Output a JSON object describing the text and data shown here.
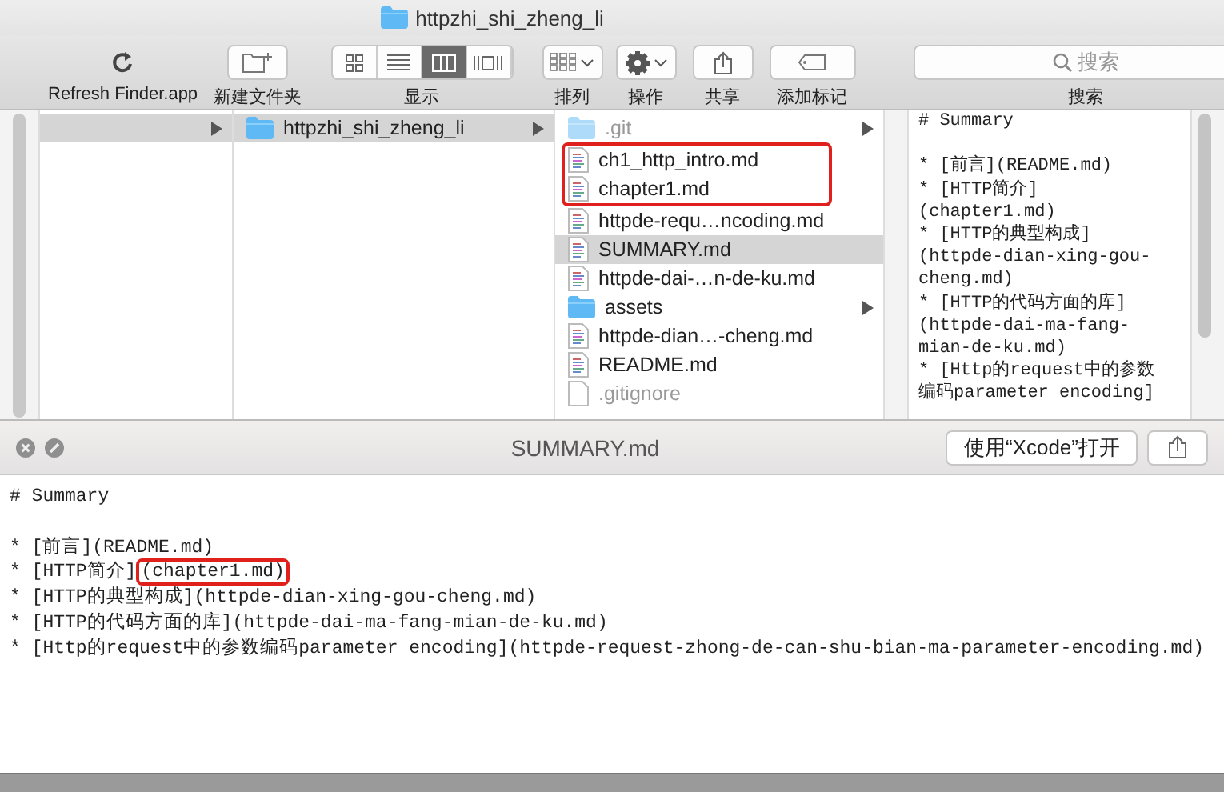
{
  "window": {
    "title": "httpzhi_shi_zheng_li"
  },
  "toolbar": {
    "items": [
      {
        "kind": "refresh",
        "label": "Refresh Finder.app"
      },
      {
        "kind": "new-folder",
        "label": "新建文件夹"
      },
      {
        "kind": "view",
        "label": "显示",
        "segments": [
          {
            "selected": false
          },
          {
            "selected": false
          },
          {
            "selected": true
          },
          {
            "selected": false
          }
        ]
      },
      {
        "kind": "sort",
        "label": "排列"
      },
      {
        "kind": "action",
        "label": "操作"
      },
      {
        "kind": "share",
        "label": "共享"
      },
      {
        "kind": "tag",
        "label": "添加标记"
      },
      {
        "kind": "search",
        "label": "搜索",
        "placeholder": "搜索"
      }
    ]
  },
  "columns": [
    {
      "items": [
        {
          "kind": "folder-row",
          "selected": true,
          "expandable": true
        }
      ]
    },
    {
      "items": [
        {
          "kind": "folder",
          "name": "httpzhi_shi_zheng_li",
          "selected": true,
          "expandable": true,
          "hidden": false,
          "highlighted": false
        }
      ]
    },
    {
      "items": [
        {
          "kind": "folder",
          "name": ".git",
          "selected": false,
          "expandable": true,
          "hidden": true,
          "highlighted": false
        },
        {
          "kind": "markdown",
          "name": "ch1_http_intro.md",
          "selected": false,
          "expandable": false,
          "hidden": false,
          "highlighted": true
        },
        {
          "kind": "markdown",
          "name": "chapter1.md",
          "selected": false,
          "expandable": false,
          "hidden": false,
          "highlighted": true
        },
        {
          "kind": "markdown",
          "name": "httpde-requ…ncoding.md",
          "selected": false,
          "expandable": false,
          "hidden": false,
          "highlighted": false
        },
        {
          "kind": "markdown",
          "name": "SUMMARY.md",
          "selected": true,
          "expandable": false,
          "hidden": false,
          "highlighted": false
        },
        {
          "kind": "markdown",
          "name": "httpde-dai-…n-de-ku.md",
          "selected": false,
          "expandable": false,
          "hidden": false,
          "highlighted": false
        },
        {
          "kind": "folder",
          "name": "assets",
          "selected": false,
          "expandable": true,
          "hidden": false,
          "highlighted": false
        },
        {
          "kind": "markdown",
          "name": "httpde-dian…-cheng.md",
          "selected": false,
          "expandable": false,
          "hidden": false,
          "highlighted": false
        },
        {
          "kind": "markdown",
          "name": "README.md",
          "selected": false,
          "expandable": false,
          "hidden": false,
          "highlighted": false
        },
        {
          "kind": "plain",
          "name": ".gitignore",
          "selected": false,
          "expandable": false,
          "hidden": true,
          "highlighted": false
        }
      ]
    }
  ],
  "finder_preview": {
    "heading": "# Summary",
    "lines": [
      "* [前言](README.md)",
      "* [HTTP简介]",
      "(chapter1.md)",
      "* [HTTP的典型构成]",
      "(httpde-dian-xing-gou-",
      "cheng.md)",
      "* [HTTP的代码方面的库]",
      "(httpde-dai-ma-fang-",
      "mian-de-ku.md)",
      "* [Http的request中的参数",
      "编码parameter encoding]"
    ]
  },
  "quick_look": {
    "title": "SUMMARY.md",
    "open_button": "使用“Xcode”打开",
    "heading": "# Summary",
    "lines": [
      {
        "text": "* [前言](README.md)"
      },
      {
        "text": "* [HTTP简介]",
        "highlight": "(chapter1.md)"
      },
      {
        "text": "* [HTTP的典型构成](httpde-dian-xing-gou-cheng.md)"
      },
      {
        "text": "* [HTTP的代码方面的库](httpde-dai-ma-fang-mian-de-ku.md)"
      },
      {
        "text": "* [Http的request中的参数编码parameter encoding](httpde-request-zhong-de-can-shu-bian-ma-parameter-encoding.md)"
      }
    ]
  }
}
